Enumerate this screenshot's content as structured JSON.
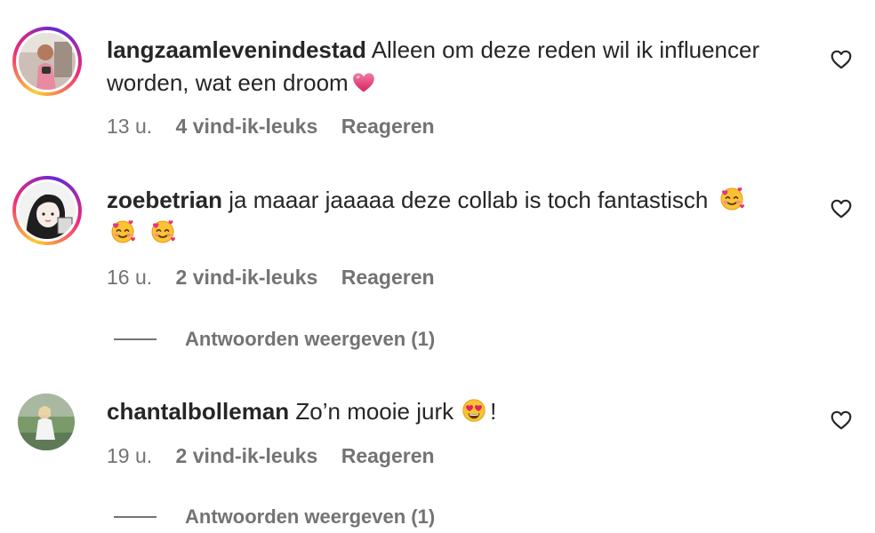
{
  "comments": [
    {
      "username": "langzaamlevenindestad",
      "text": "Alleen om deze reden wil ik influencer worden, wat een droom",
      "emoji": "pink-heart",
      "time": "13 u.",
      "likes": "4 vind-ik-leuks",
      "reply_label": "Reageren",
      "has_story_ring": true
    },
    {
      "username": "zoebetrian",
      "text": "ja maaar jaaaaa deze collab is toch fantastisch",
      "emoji": "smiling-face-with-hearts x3",
      "time": "16 u.",
      "likes": "2 vind-ik-leuks",
      "reply_label": "Reageren",
      "view_replies": "Antwoorden weergeven (1)",
      "has_story_ring": true
    },
    {
      "username": "chantalbolleman",
      "text": "Zo’n mooie jurk",
      "text_after": "!",
      "emoji": "heart-eyes",
      "time": "19 u.",
      "likes": "2 vind-ik-leuks",
      "reply_label": "Reageren",
      "view_replies": "Antwoorden weergeven (1)",
      "has_story_ring": false
    }
  ],
  "colors": {
    "text": "#262626",
    "secondary": "#737373",
    "story_ring": [
      "#f9ce34",
      "#ee2a7b",
      "#6228d7"
    ]
  }
}
